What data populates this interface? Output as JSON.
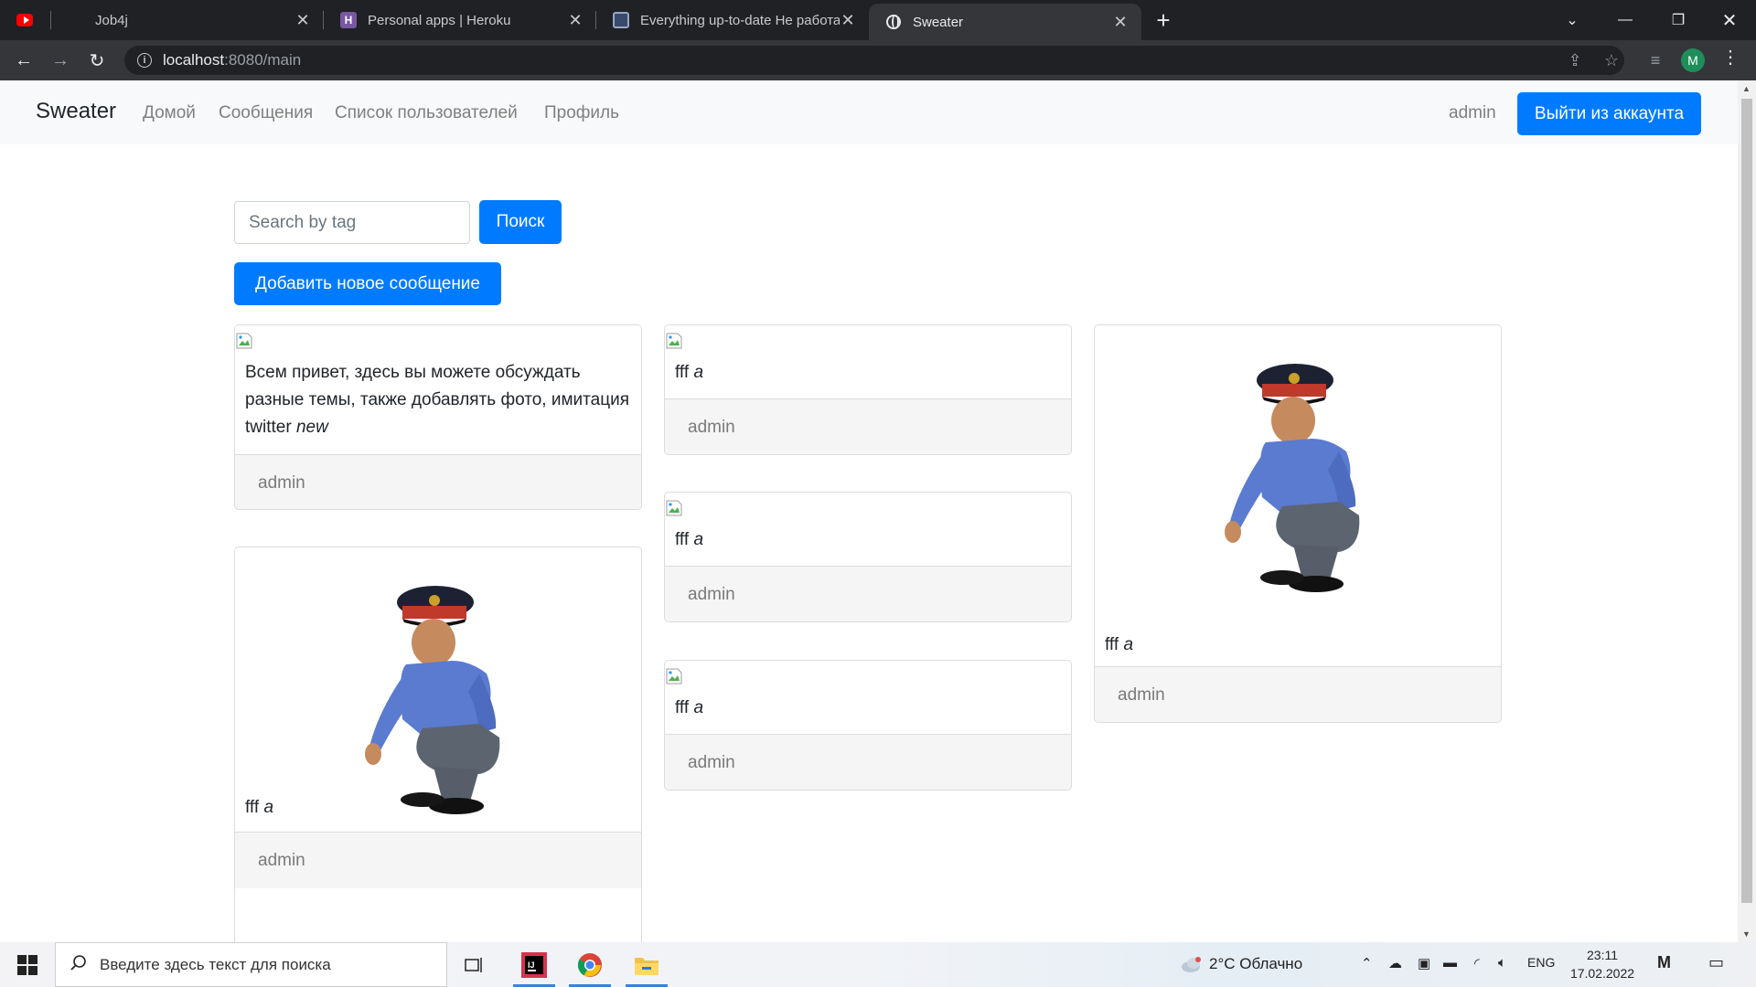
{
  "browser": {
    "tabs": [
      {
        "title": ""
      },
      {
        "title": "Job4j"
      },
      {
        "title": "Personal apps | Heroku"
      },
      {
        "title": "Everything up-to-date Не работает"
      },
      {
        "title": "Sweater"
      }
    ],
    "url_host": "localhost",
    "url_path": ":8080/main",
    "profile_initial": "M"
  },
  "navbar": {
    "brand": "Sweater",
    "links": [
      "Домой",
      "Сообщения",
      "Список пользователей",
      "Профиль"
    ],
    "username": "admin",
    "logout_label": "Выйти из аккаунта"
  },
  "search": {
    "placeholder": "Search by tag",
    "button_label": "Поиск"
  },
  "add_message_label": "Добавить новое сообщение",
  "messages": [
    {
      "text": "Всем привет, здесь вы можете обсуждать разные темы, также добавлять фото, имитация twitter",
      "tag": "new",
      "author": "admin",
      "image": "broken"
    },
    {
      "text": "fff",
      "tag": "a",
      "author": "admin",
      "image": "policeman-photo"
    },
    {
      "text": "fff",
      "tag": "a",
      "author": "admin",
      "image": "broken"
    },
    {
      "text": "fff",
      "tag": "a",
      "author": "admin",
      "image": "broken"
    },
    {
      "text": "fff",
      "tag": "a",
      "author": "admin",
      "image": "broken"
    },
    {
      "text": "fff",
      "tag": "a",
      "author": "admin",
      "image": "policeman-photo"
    }
  ],
  "taskbar": {
    "search_placeholder": "Введите здесь текст для поиска",
    "weather": "2°C  Облачно",
    "language": "ENG",
    "time": "23:11",
    "date": "17.02.2022"
  },
  "colors": {
    "primary": "#007bff",
    "navbar_bg": "#f8f9fa",
    "chrome_dark": "#202124"
  }
}
